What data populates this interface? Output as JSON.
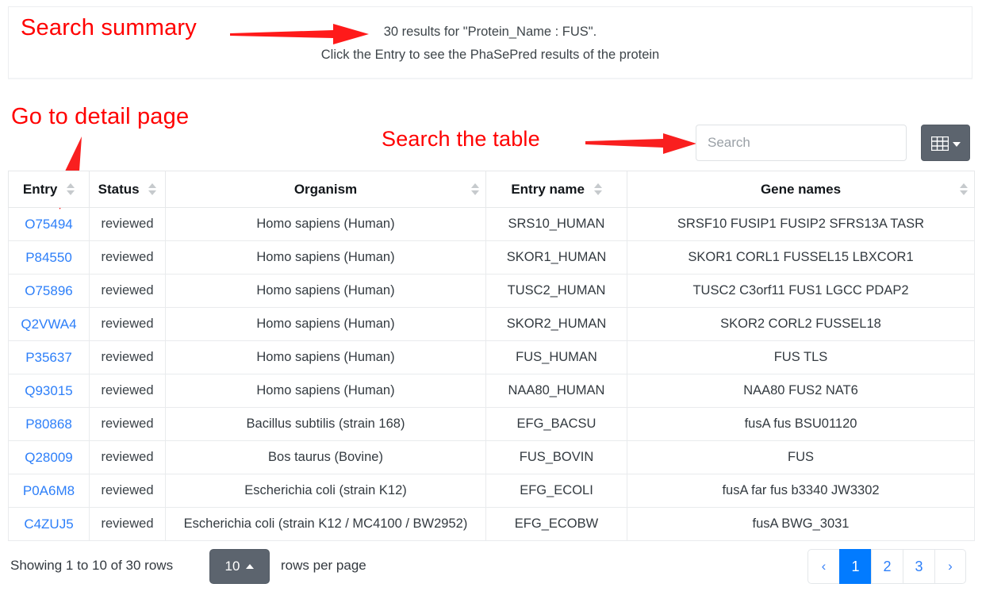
{
  "summary": {
    "line1": "30 results for \"Protein_Name : FUS\".",
    "line2": "Click the Entry to see the PhaSePred results of the protein"
  },
  "annotations": {
    "search_summary": "Search summary",
    "go_to_detail": "Go to detail page",
    "search_the_table": "Search the table",
    "color": "#ff0000"
  },
  "toolbar": {
    "search_placeholder": "Search",
    "search_value": "",
    "columns_button_title": "Columns"
  },
  "table": {
    "columns": [
      {
        "label": "Entry",
        "sortable": true
      },
      {
        "label": "Status",
        "sortable": true
      },
      {
        "label": "Organism",
        "sortable": true
      },
      {
        "label": "Entry name",
        "sortable": true
      },
      {
        "label": "Gene names",
        "sortable": true
      }
    ],
    "rows": [
      {
        "entry": "O75494",
        "status": "reviewed",
        "organism": "Homo sapiens (Human)",
        "entry_name": "SRS10_HUMAN",
        "gene_names": "SRSF10 FUSIP1 FUSIP2 SFRS13A TASR"
      },
      {
        "entry": "P84550",
        "status": "reviewed",
        "organism": "Homo sapiens (Human)",
        "entry_name": "SKOR1_HUMAN",
        "gene_names": "SKOR1 CORL1 FUSSEL15 LBXCOR1"
      },
      {
        "entry": "O75896",
        "status": "reviewed",
        "organism": "Homo sapiens (Human)",
        "entry_name": "TUSC2_HUMAN",
        "gene_names": "TUSC2 C3orf11 FUS1 LGCC PDAP2"
      },
      {
        "entry": "Q2VWA4",
        "status": "reviewed",
        "organism": "Homo sapiens (Human)",
        "entry_name": "SKOR2_HUMAN",
        "gene_names": "SKOR2 CORL2 FUSSEL18"
      },
      {
        "entry": "P35637",
        "status": "reviewed",
        "organism": "Homo sapiens (Human)",
        "entry_name": "FUS_HUMAN",
        "gene_names": "FUS TLS"
      },
      {
        "entry": "Q93015",
        "status": "reviewed",
        "organism": "Homo sapiens (Human)",
        "entry_name": "NAA80_HUMAN",
        "gene_names": "NAA80 FUS2 NAT6"
      },
      {
        "entry": "P80868",
        "status": "reviewed",
        "organism": "Bacillus subtilis (strain 168)",
        "entry_name": "EFG_BACSU",
        "gene_names": "fusA fus BSU01120"
      },
      {
        "entry": "Q28009",
        "status": "reviewed",
        "organism": "Bos taurus (Bovine)",
        "entry_name": "FUS_BOVIN",
        "gene_names": "FUS"
      },
      {
        "entry": "P0A6M8",
        "status": "reviewed",
        "organism": "Escherichia coli (strain K12)",
        "entry_name": "EFG_ECOLI",
        "gene_names": "fusA far fus b3340 JW3302"
      },
      {
        "entry": "C4ZUJ5",
        "status": "reviewed",
        "organism": "Escherichia coli (strain K12 / MC4100 / BW2952)",
        "entry_name": "EFG_ECOBW",
        "gene_names": "fusA BWG_3031"
      }
    ]
  },
  "footer": {
    "showing": "Showing 1 to 10 of 30 rows",
    "page_size": "10",
    "rows_per_page_label": "rows per page",
    "pagination": [
      {
        "label": "‹",
        "type": "prev",
        "active": false
      },
      {
        "label": "1",
        "type": "page",
        "active": true
      },
      {
        "label": "2",
        "type": "page",
        "active": false
      },
      {
        "label": "3",
        "type": "page",
        "active": false
      },
      {
        "label": "›",
        "type": "next",
        "active": false
      }
    ],
    "active_color": "#027bff",
    "link_color": "#2d7ff9"
  }
}
